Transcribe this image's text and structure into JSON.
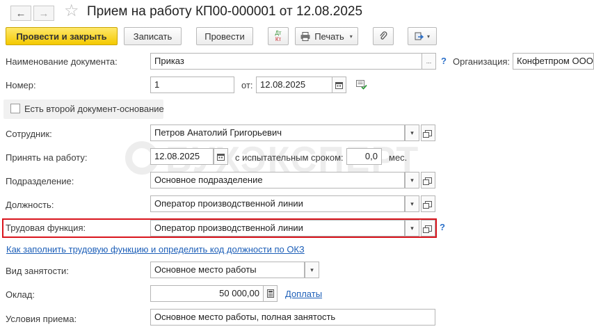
{
  "window": {
    "title": "Прием на работу КП00-000001 от 12.08.2025",
    "back_icon": "←",
    "forward_icon": "→",
    "star_icon": "☆"
  },
  "toolbar": {
    "post_close_label": "Провести и закрыть",
    "save_label": "Записать",
    "post_label": "Провести",
    "dtkt_top": "Дт",
    "dtkt_bottom": "Кт",
    "print_label": "Печать",
    "dropdown_arrow": "▾",
    "attach_icon": "📎"
  },
  "form": {
    "doc_name": {
      "label": "Наименование документа:",
      "value": "Приказ",
      "button": "..."
    },
    "organization": {
      "label": "Организация:",
      "value": "Конфетпром ООО",
      "help": "?"
    },
    "number": {
      "label": "Номер:",
      "value": "1"
    },
    "date": {
      "label": "от:",
      "value": "12.08.2025"
    },
    "second_doc": {
      "label": "Есть второй документ-основание",
      "checked": false
    },
    "employee": {
      "label": "Сотрудник:",
      "value": "Петров Анатолий Григорьевич"
    },
    "hire_date": {
      "label": "Принять на работу:",
      "value": "12.08.2025"
    },
    "probation": {
      "label": "с испытательным сроком:",
      "value": "0,0",
      "unit": "мес."
    },
    "department": {
      "label": "Подразделение:",
      "value": "Основное подразделение"
    },
    "position": {
      "label": "Должность:",
      "value": "Оператор производственной линии"
    },
    "labor_function": {
      "label": "Трудовая функция:",
      "value": "Оператор производственной линии",
      "help": "?"
    },
    "okz_link": "Как заполнить трудовую функцию и определить код должности по ОКЗ",
    "employment_type": {
      "label": "Вид занятости:",
      "value": "Основное место работы"
    },
    "salary": {
      "label": "Оклад:",
      "value": "50 000,00",
      "link": "Доплаты"
    },
    "conditions": {
      "label": "Условия приема:",
      "value": "Основное место работы, полная занятость"
    }
  },
  "icons": {
    "dropdown": "▾",
    "calendar": "▦",
    "calculator": "▦"
  },
  "watermark": "БУХЭКСПЕРТ",
  "colors": {
    "primary_button": "#f4c900",
    "highlight_border": "#d9141c",
    "link": "#1d5fb8"
  }
}
